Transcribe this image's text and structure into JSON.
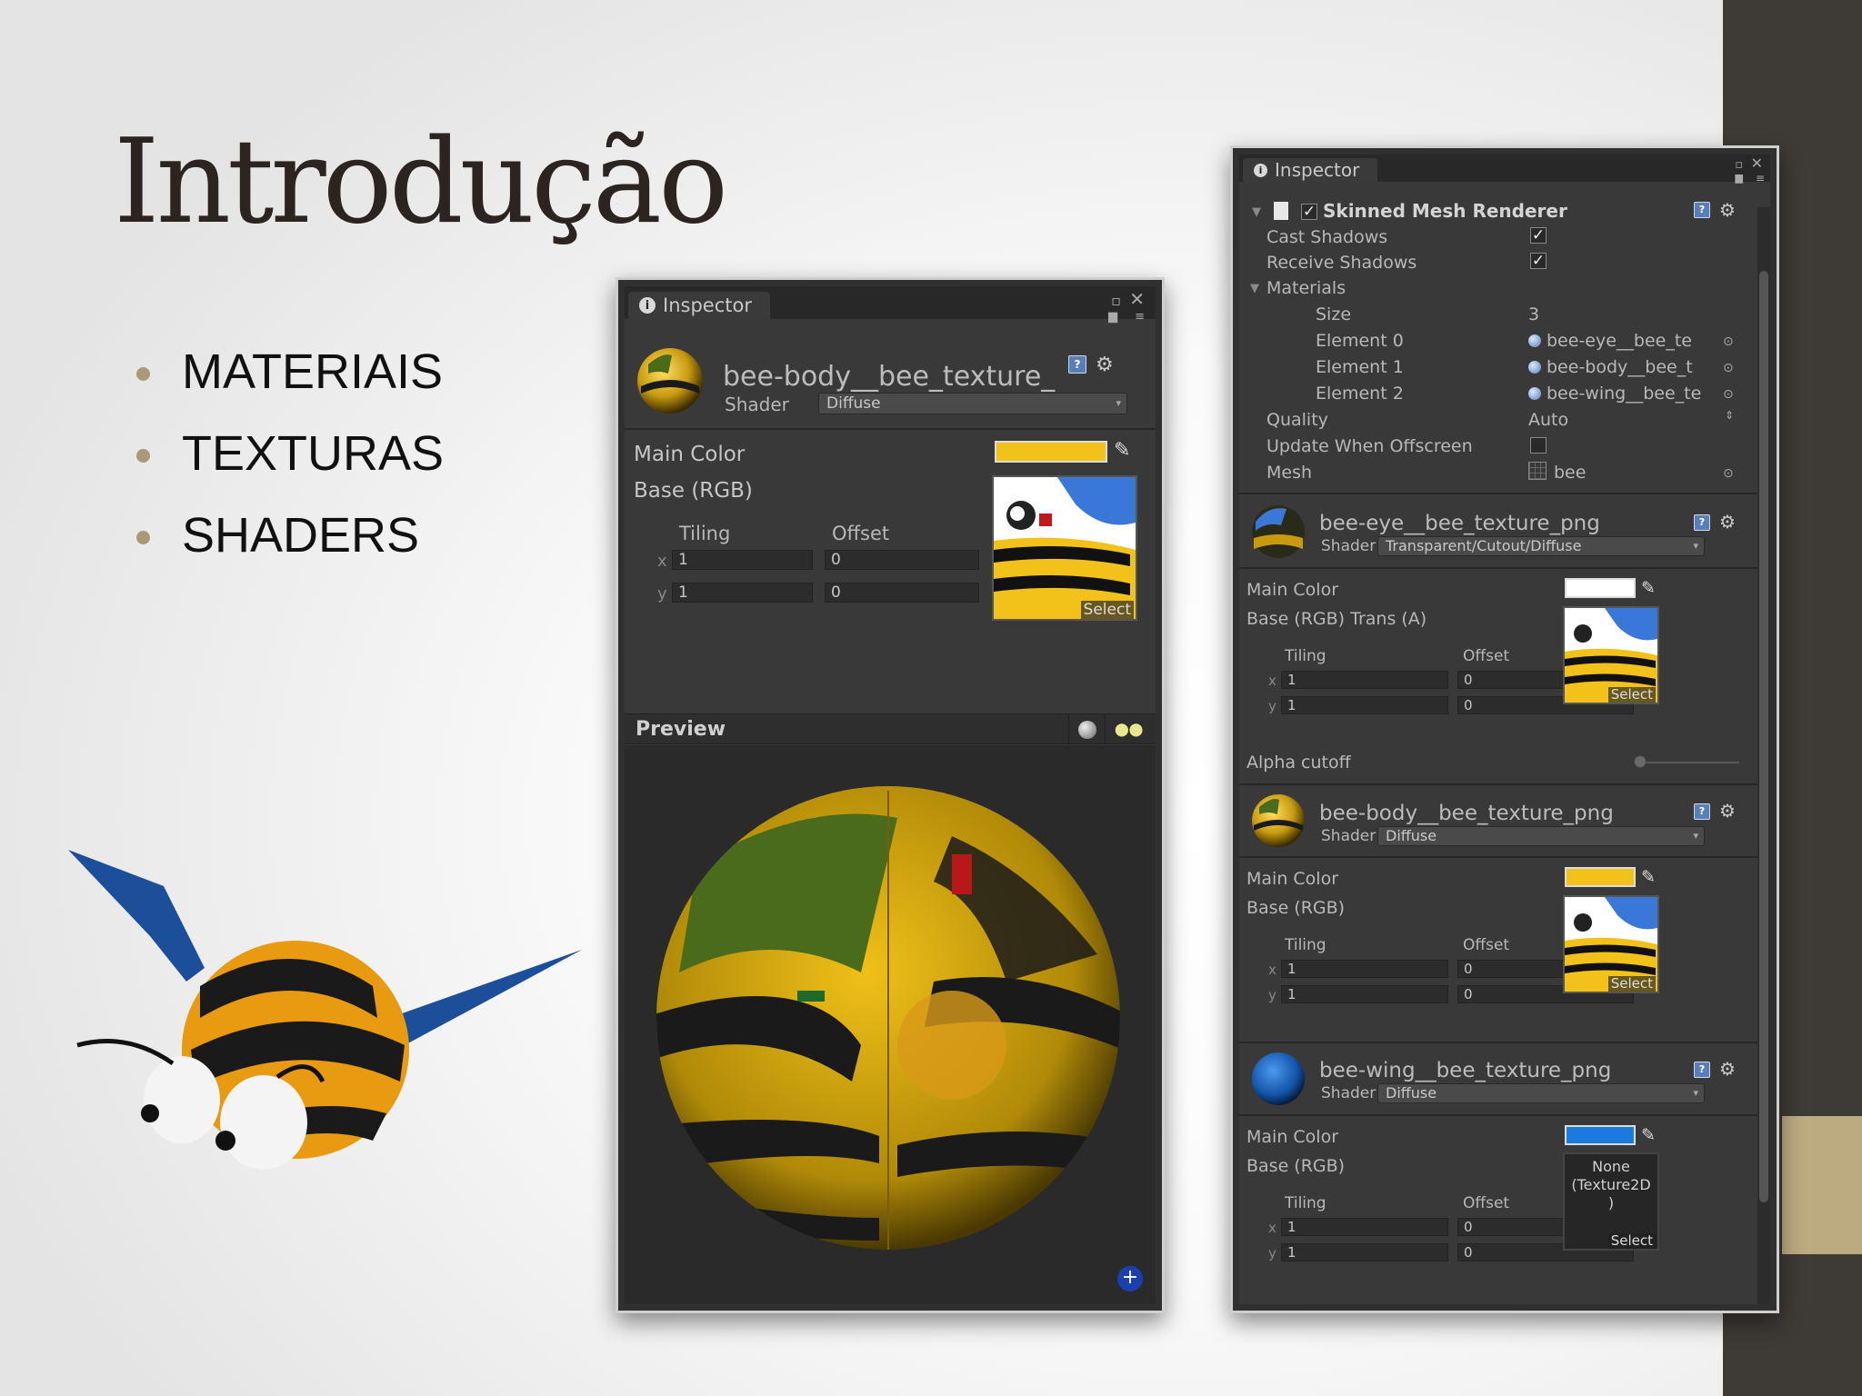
{
  "slide": {
    "title": "Introdução",
    "bullets": [
      "MATERIAIS",
      "TEXTURAS",
      "SHADERS"
    ]
  },
  "colors": {
    "accent": "#bcaa80",
    "yellow_color": "#f2c21a",
    "white_color": "#ffffff",
    "blue_color": "#1a7ae0"
  },
  "left_inspector": {
    "tab": "Inspector",
    "material_name": "bee-body__bee_texture_",
    "shader_label": "Shader",
    "shader_value": "Diffuse",
    "main_color_label": "Main Color",
    "base_label": "Base (RGB)",
    "tiling_label": "Tiling",
    "offset_label": "Offset",
    "x_label": "x",
    "y_label": "y",
    "tiling_x": "1",
    "tiling_y": "1",
    "offset_x": "0",
    "offset_y": "0",
    "select_label": "Select",
    "preview_label": "Preview"
  },
  "right_inspector": {
    "tab": "Inspector",
    "component_title": "Skinned Mesh Renderer",
    "cast_shadows_label": "Cast Shadows",
    "receive_shadows_label": "Receive Shadows",
    "materials_label": "Materials",
    "size_label": "Size",
    "size_value": "3",
    "elements": [
      {
        "label": "Element 0",
        "value": "bee-eye__bee_te"
      },
      {
        "label": "Element 1",
        "value": "bee-body__bee_t"
      },
      {
        "label": "Element 2",
        "value": "bee-wing__bee_te"
      }
    ],
    "quality_label": "Quality",
    "quality_value": "Auto",
    "update_offscreen_label": "Update When Offscreen",
    "mesh_label": "Mesh",
    "mesh_value": "bee",
    "materials": [
      {
        "name": "bee-eye__bee_texture_png",
        "shader": "Transparent/Cutout/Diffuse",
        "main_color": "Main Color",
        "base": "Base (RGB) Trans (A)",
        "tiling": "Tiling",
        "offset": "Offset",
        "x": "x",
        "y": "y",
        "tx": "1",
        "ty": "1",
        "ox": "0",
        "oy": "0",
        "select": "Select",
        "alpha_cutoff": "Alpha cutoff"
      },
      {
        "name": "bee-body__bee_texture_png",
        "shader": "Diffuse",
        "main_color": "Main Color",
        "base": "Base (RGB)",
        "tiling": "Tiling",
        "offset": "Offset",
        "x": "x",
        "y": "y",
        "tx": "1",
        "ty": "1",
        "ox": "0",
        "oy": "0",
        "select": "Select"
      },
      {
        "name": "bee-wing__bee_texture_png",
        "shader": "Diffuse",
        "main_color": "Main Color",
        "base": "Base (RGB)",
        "tiling": "Tiling",
        "offset": "Offset",
        "x": "x",
        "y": "y",
        "tx": "1",
        "ty": "1",
        "ox": "0",
        "oy": "0",
        "select": "Select",
        "none_texture": "None (Texture2D )"
      }
    ],
    "shader_label": "Shader"
  }
}
